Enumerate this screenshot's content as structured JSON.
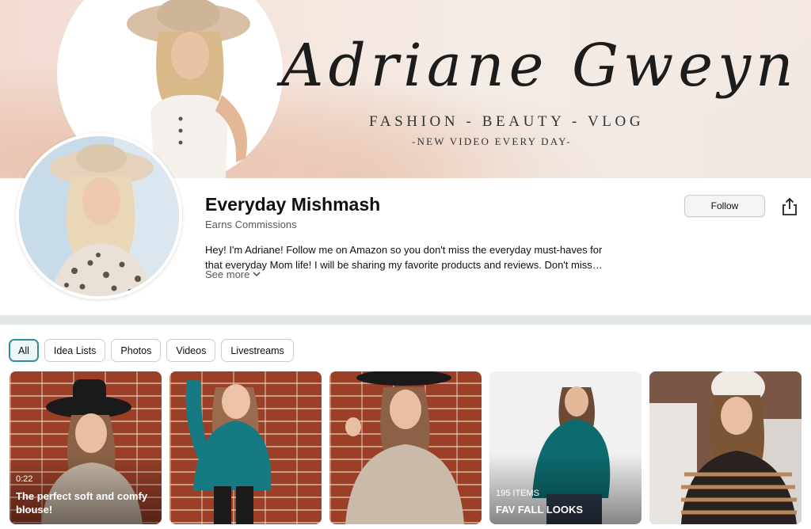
{
  "banner": {
    "script_name": "Adriane Gweyn",
    "tagline": "FASHION - BEAUTY - VLOG",
    "subtagline": "-NEW VIDEO EVERY DAY-"
  },
  "profile": {
    "name": "Everyday Mishmash",
    "subtitle": "Earns Commissions",
    "bio": "Hey! I'm Adriane! Follow me on Amazon so you don't miss the everyday must-haves for that everyday Mom life! I will be sharing my favorite products and reviews. Don't miss…",
    "see_more": "See more",
    "follow_label": "Follow"
  },
  "tabs": [
    "All",
    "Idea Lists",
    "Photos",
    "Videos",
    "Livestreams"
  ],
  "active_tab": "All",
  "cards": [
    {
      "kind": "video",
      "duration": "0:22",
      "title": "The perfect soft and comfy blouse!"
    },
    {
      "kind": "photo"
    },
    {
      "kind": "photo"
    },
    {
      "kind": "list",
      "count": "195 ITEMS",
      "title": "FAV FALL LOOKS"
    },
    {
      "kind": "photo"
    }
  ],
  "colors": {
    "accent": "#2f8b9a",
    "divider": "#e3e6e6",
    "follow_bg": "#f3f4f4"
  },
  "icons": {
    "share": "share-icon",
    "chevron": "chevron-down-icon"
  }
}
